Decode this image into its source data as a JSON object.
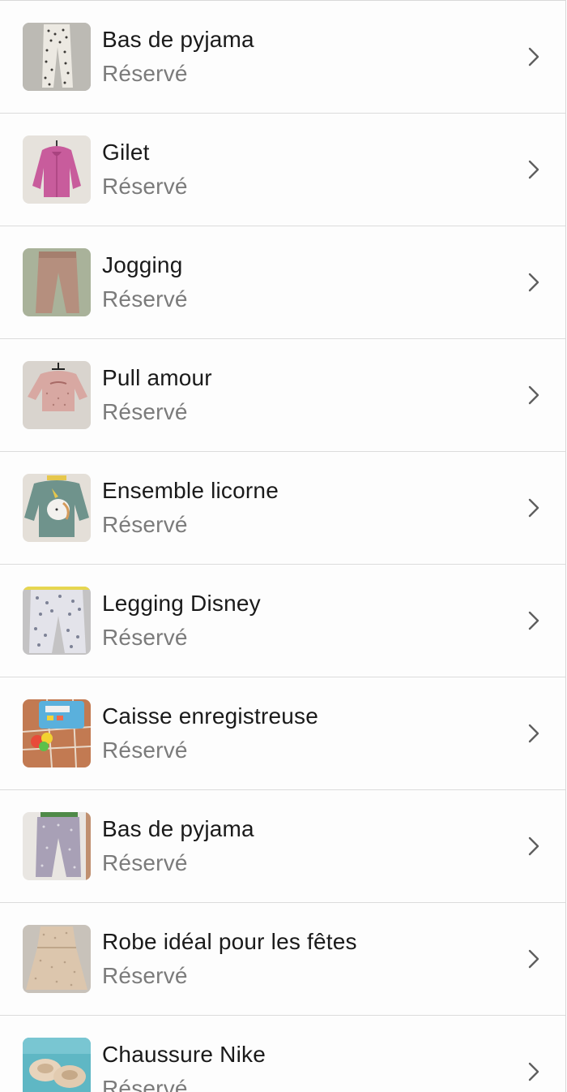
{
  "items": [
    {
      "title": "Bas de pyjama",
      "status": "Réservé",
      "thumb": "pajama-pants-floral"
    },
    {
      "title": "Gilet",
      "status": "Réservé",
      "thumb": "pink-cardigan"
    },
    {
      "title": "Jogging",
      "status": "Réservé",
      "thumb": "brown-jogging-pants"
    },
    {
      "title": "Pull amour",
      "status": "Réservé",
      "thumb": "pink-sweater"
    },
    {
      "title": "Ensemble licorne",
      "status": "Réservé",
      "thumb": "unicorn-outfit"
    },
    {
      "title": "Legging Disney",
      "status": "Réservé",
      "thumb": "printed-legging"
    },
    {
      "title": "Caisse enregistreuse",
      "status": "Réservé",
      "thumb": "toy-cash-register"
    },
    {
      "title": "Bas de pyjama",
      "status": "Réservé",
      "thumb": "purple-pajama-pants"
    },
    {
      "title": "Robe idéal pour les fêtes",
      "status": "Réservé",
      "thumb": "beige-dress"
    },
    {
      "title": "Chaussure Nike",
      "status": "Réservé",
      "thumb": "nike-shoes"
    }
  ],
  "icons": {
    "row_action": "chevron-right-icon"
  },
  "colors": {
    "title": "#1a1a1a",
    "status": "#7b7b7b",
    "chevron": "#5f5f5f",
    "divider": "#dcdcdc"
  }
}
